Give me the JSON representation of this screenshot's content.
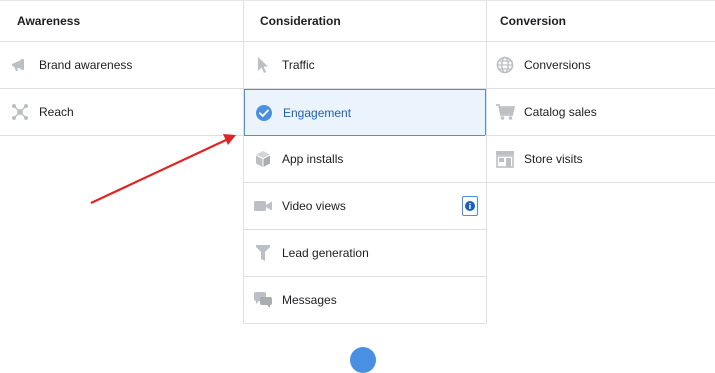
{
  "columns": {
    "awareness": {
      "header": "Awareness",
      "items": [
        {
          "label": "Brand awareness",
          "icon": "megaphone-icon"
        },
        {
          "label": "Reach",
          "icon": "reach-icon"
        }
      ]
    },
    "consideration": {
      "header": "Consideration",
      "items": [
        {
          "label": "Traffic",
          "icon": "cursor-icon"
        },
        {
          "label": "Engagement",
          "icon": "check-circle-icon",
          "selected": true
        },
        {
          "label": "App installs",
          "icon": "box-icon"
        },
        {
          "label": "Video views",
          "icon": "video-camera-icon",
          "info": "info-icon"
        },
        {
          "label": "Lead generation",
          "icon": "funnel-icon"
        },
        {
          "label": "Messages",
          "icon": "chat-bubbles-icon"
        }
      ]
    },
    "conversion": {
      "header": "Conversion",
      "items": [
        {
          "label": "Conversions",
          "icon": "globe-icon"
        },
        {
          "label": "Catalog sales",
          "icon": "shopping-cart-icon"
        },
        {
          "label": "Store visits",
          "icon": "store-icon"
        }
      ]
    }
  },
  "colors": {
    "accent": "#4a90e2",
    "selected_bg": "#ebf3fd",
    "selected_text": "#1d5fb8",
    "icon_gray": "#bcc0c4",
    "annotation_arrow": "#e02424"
  }
}
